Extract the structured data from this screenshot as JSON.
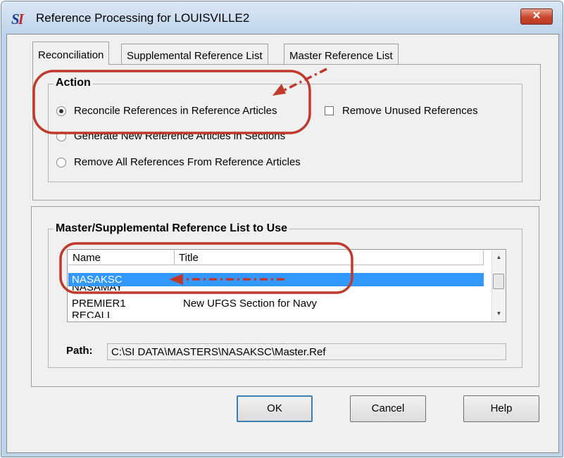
{
  "window": {
    "title": "Reference Processing for LOUISVILLE2",
    "close_label": "✕"
  },
  "tabs": [
    {
      "label": "Reconciliation",
      "active": true
    },
    {
      "label": "Supplemental Reference List"
    },
    {
      "label": "Master Reference List"
    }
  ],
  "action": {
    "legend": "Action",
    "options": [
      {
        "label": "Reconcile References in Reference Articles",
        "selected": true
      },
      {
        "label": "Generate New Reference Articles in Sections",
        "selected": false
      },
      {
        "label": "Remove All References From Reference Articles",
        "selected": false
      }
    ],
    "remove_unused": {
      "label": "Remove Unused References",
      "checked": false
    }
  },
  "reflist": {
    "legend": "Master/Supplemental Reference List to Use",
    "columns": [
      "Name",
      "Title"
    ],
    "rows": [
      {
        "name": "NASAKSC",
        "title": "",
        "selected": true
      },
      {
        "name": "NASAMAY",
        "title": ""
      },
      {
        "name": "PREMIER1",
        "title": "New UFGS Section for Navy"
      },
      {
        "name": "RECALL",
        "title": ""
      }
    ],
    "path_label": "Path:",
    "path_value": "C:\\SI DATA\\MASTERS\\NASAKSC\\Master.Ref"
  },
  "buttons": {
    "ok": "OK",
    "cancel": "Cancel",
    "help": "Help"
  },
  "colors": {
    "annotation": "#c0392b",
    "selection": "#3399ff"
  }
}
